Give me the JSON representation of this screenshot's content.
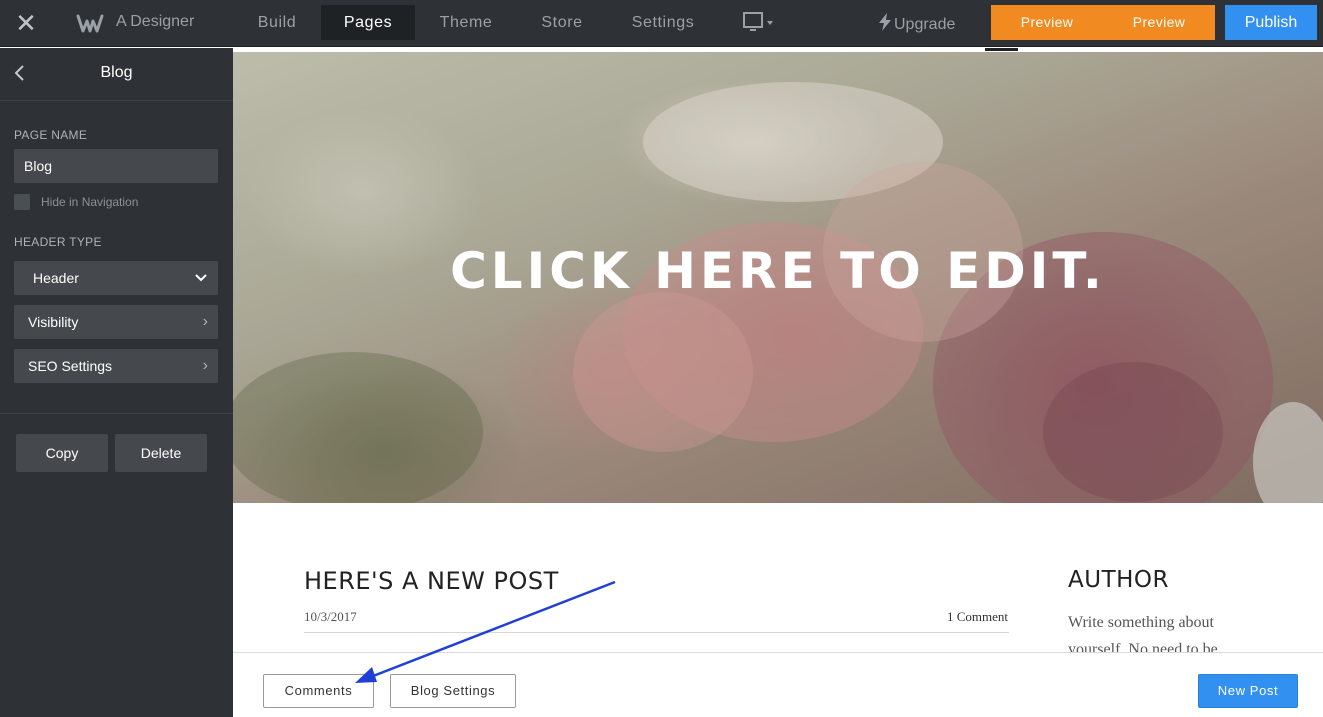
{
  "topbar": {
    "site_name": "A Designer",
    "tabs": [
      {
        "label": "Build"
      },
      {
        "label": "Pages"
      },
      {
        "label": "Theme"
      },
      {
        "label": "Store"
      },
      {
        "label": "Settings"
      }
    ],
    "active_tab": "Pages",
    "upgrade_label": "Upgrade",
    "preview_labels": [
      "Preview",
      "Preview"
    ],
    "publish_label": "Publish",
    "colors": {
      "preview": "#f28a22",
      "publish": "#3290f0",
      "bar": "#2e3236"
    }
  },
  "sidebar": {
    "title": "Blog",
    "page_name_label": "PAGE NAME",
    "page_name_value": "Blog",
    "hide_in_nav_label": "Hide in Navigation",
    "hide_in_nav_checked": false,
    "header_type_label": "HEADER TYPE",
    "header_type_value": "Header",
    "visibility_label": "Visibility",
    "seo_label": "SEO Settings",
    "copy_label": "Copy",
    "delete_label": "Delete"
  },
  "canvas": {
    "hero_title": "CLICK HERE TO EDIT.",
    "post": {
      "title": "HERE'S A NEW POST",
      "date": "10/3/2017",
      "comments": "1 Comment"
    },
    "author": {
      "title": "AUTHOR",
      "text": "Write something about yourself. No need to be"
    }
  },
  "bottombar": {
    "comments_label": "Comments",
    "blog_settings_label": "Blog Settings",
    "new_post_label": "New Post"
  },
  "annotation": {
    "color": "#1f3fd6"
  }
}
